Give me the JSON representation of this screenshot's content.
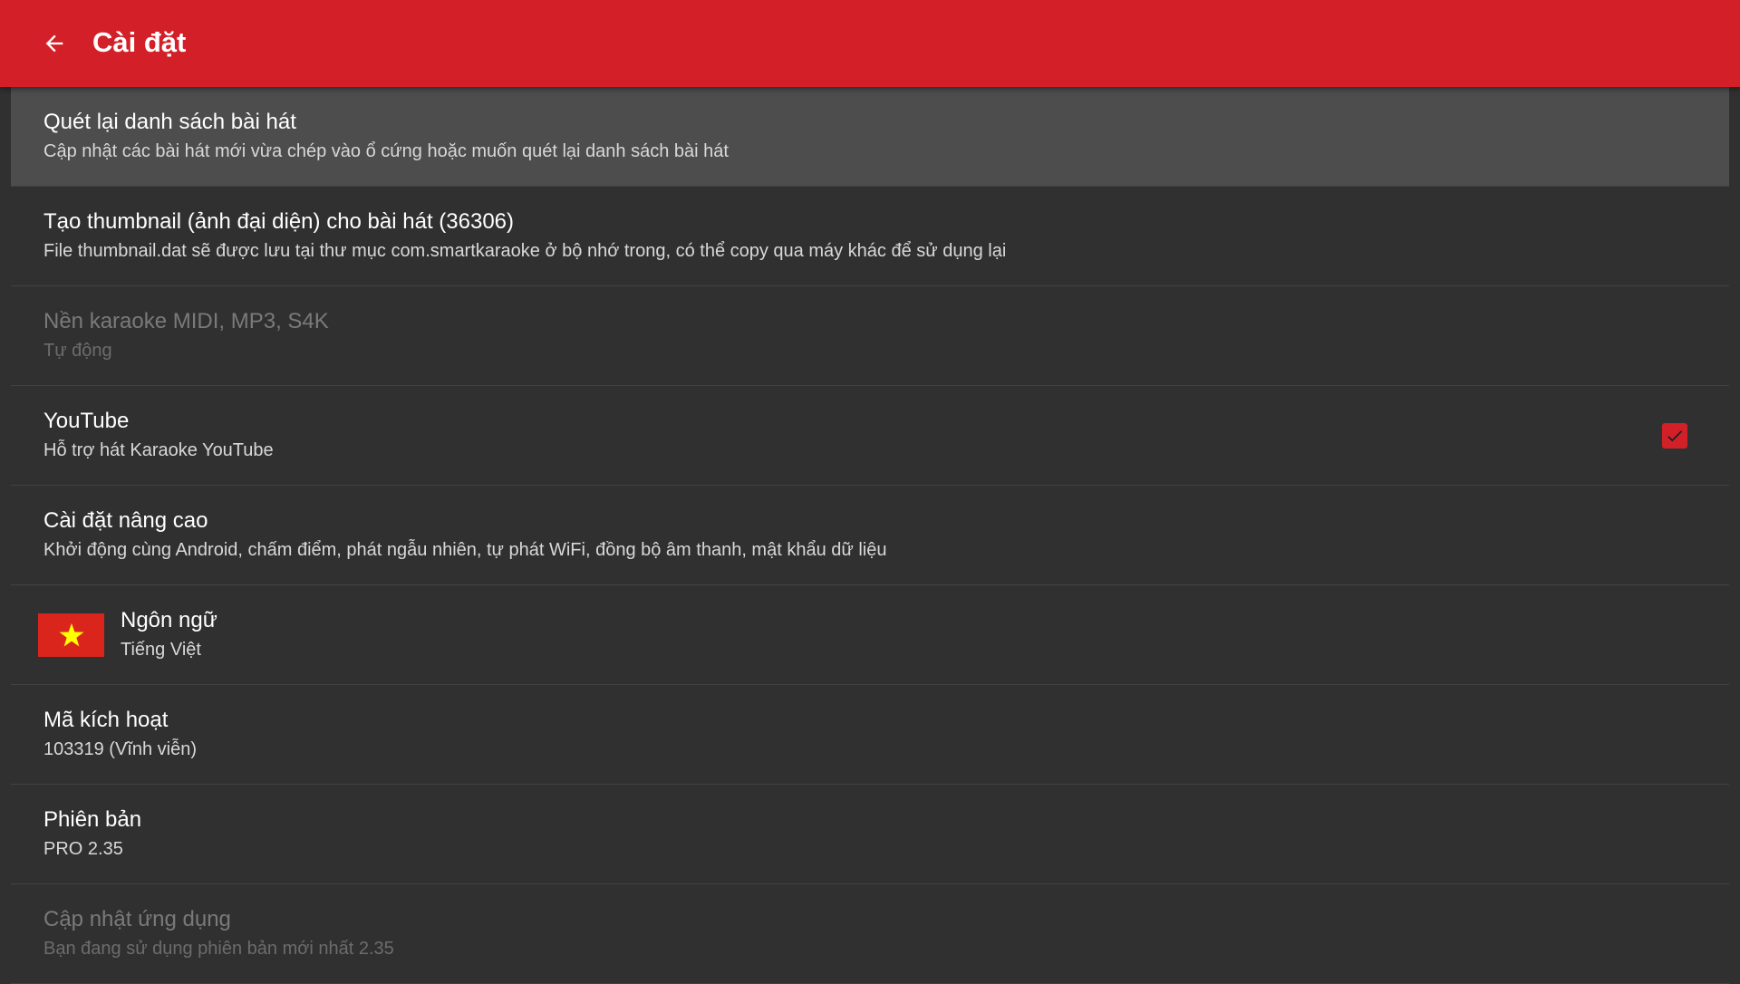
{
  "appbar": {
    "title": "Cài đặt",
    "back_icon": "arrow-back-icon"
  },
  "colors": {
    "accent": "#d32028",
    "background": "#303030",
    "selected_row": "#4d4d4d",
    "flag_red": "#da251d",
    "flag_star": "#ffff00"
  },
  "settings": [
    {
      "title": "Quét lại danh sách bài hát",
      "summary": "Cập nhật các bài hát mới vừa chép vào ổ cứng hoặc muốn quét lại danh sách bài hát",
      "enabled": true,
      "selected": true
    },
    {
      "title": "Tạo thumbnail (ảnh đại diện) cho bài hát (36306)",
      "summary": "File thumbnail.dat sẽ được lưu tại thư mục com.smartkaraoke ở bộ nhớ trong, có thể copy qua máy khác để sử dụng lại",
      "enabled": true
    },
    {
      "title": "Nền karaoke MIDI, MP3, S4K",
      "summary": "Tự động",
      "enabled": false
    },
    {
      "title": "YouTube",
      "summary": "Hỗ trợ hát Karaoke YouTube",
      "enabled": true,
      "checked": true
    },
    {
      "title": "Cài đặt nâng cao",
      "summary": "Khởi động cùng Android, chấm điểm, phát ngẫu nhiên, tự phát WiFi, đồng bộ âm thanh, mật khẩu dữ liệu",
      "enabled": true
    },
    {
      "title": "Ngôn ngữ",
      "summary": "Tiếng Việt",
      "enabled": true,
      "icon": "vietnam-flag-icon"
    },
    {
      "title": "Mã kích hoạt",
      "summary": "103319 (Vĩnh viễn)",
      "enabled": true
    },
    {
      "title": "Phiên bản",
      "summary": "PRO 2.35",
      "enabled": true
    },
    {
      "title": "Cập nhật ứng dụng",
      "summary": "Bạn đang sử dụng phiên bản mới nhất 2.35",
      "enabled": false
    }
  ]
}
